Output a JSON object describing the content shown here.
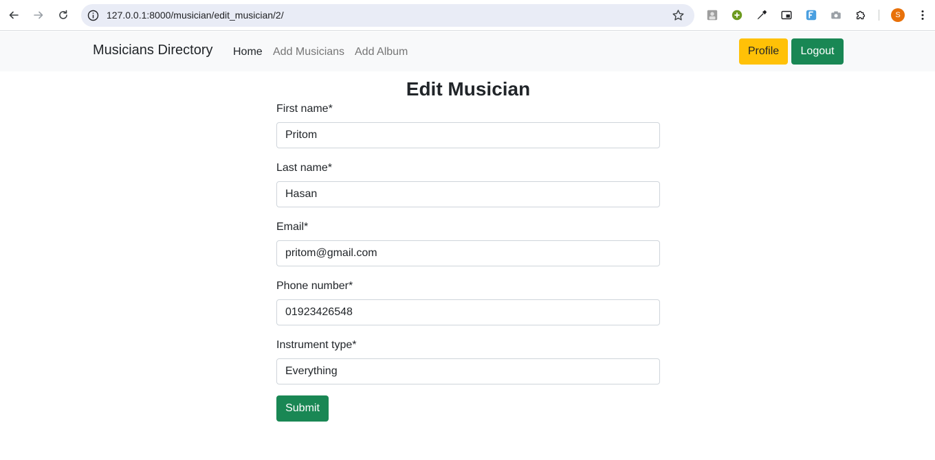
{
  "browser": {
    "url": "127.0.0.1:8000/musician/edit_musician/2/",
    "profile_initial": "S"
  },
  "navbar": {
    "brand": "Musicians Directory",
    "links": [
      "Home",
      "Add Musicians",
      "Add Album"
    ],
    "profile_label": "Profile",
    "logout_label": "Logout"
  },
  "form": {
    "title": "Edit Musician",
    "fields": [
      {
        "label": "First name*",
        "value": "Pritom"
      },
      {
        "label": "Last name*",
        "value": "Hasan"
      },
      {
        "label": "Email*",
        "value": "pritom@gmail.com"
      },
      {
        "label": "Phone number*",
        "value": "01923426548"
      },
      {
        "label": "Instrument type*",
        "value": "Everything"
      }
    ],
    "submit_label": "Submit"
  },
  "colors": {
    "warning": "#ffc107",
    "success": "#198754",
    "navbar_bg": "#f8f9fa"
  }
}
